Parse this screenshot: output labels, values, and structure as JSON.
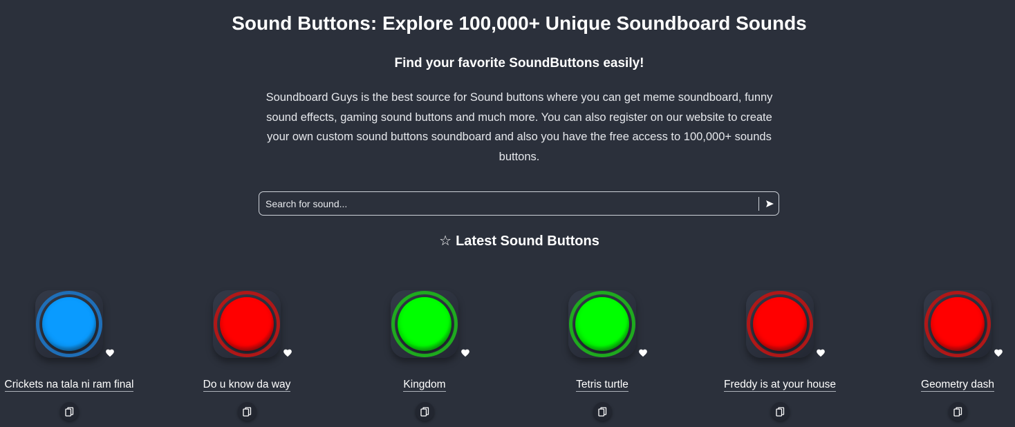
{
  "header": {
    "title": "Sound Buttons: Explore 100,000+ Unique Soundboard Sounds",
    "subtitle": "Find your favorite SoundButtons easily!",
    "description": "Soundboard Guys is the best source for Sound buttons where you can get meme soundboard, funny sound effects, gaming sound buttons and much more. You can also register on our website to create your own custom sound buttons soundboard and also you have the free access to 100,000+ sounds buttons."
  },
  "search": {
    "placeholder": "Search for sound...",
    "submit_icon": "send-arrow-icon"
  },
  "latest": {
    "star_icon": "☆",
    "title": "Latest Sound Buttons"
  },
  "sounds": [
    {
      "name": "Crickets na tala ni ram final",
      "color": "#0a9bff",
      "ring": "#1f6fb8"
    },
    {
      "name": "Do u know da way",
      "color": "#ff0000",
      "ring": "#b01818"
    },
    {
      "name": "Kingdom",
      "color": "#00ff00",
      "ring": "#1faa1f"
    },
    {
      "name": "Tetris turtle",
      "color": "#00ff00",
      "ring": "#1faa1f"
    },
    {
      "name": "Freddy is at your house",
      "color": "#ff0000",
      "ring": "#b01818"
    },
    {
      "name": "Geometry dash",
      "color": "#ff0000",
      "ring": "#b01818"
    }
  ],
  "icons": {
    "favorite": "heart-icon",
    "copy": "copy-icon"
  }
}
